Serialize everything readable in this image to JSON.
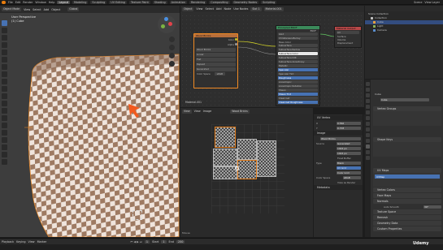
{
  "app": {
    "menu": [
      "File",
      "Edit",
      "Render",
      "Window",
      "Help"
    ],
    "workspaces": [
      "Layout",
      "Modeling",
      "Sculpting",
      "UV Editing",
      "Texture Paint",
      "Shading",
      "Animation",
      "Rendering",
      "Compositing",
      "Geometry Nodes",
      "Scripting"
    ],
    "active_workspace": "Layout",
    "scene": "Scene",
    "view_layer": "View Layer"
  },
  "viewport": {
    "mode": "Object Mode",
    "menus": [
      "View",
      "Select",
      "Add",
      "Object"
    ],
    "view_title": "User Perspective",
    "object_label": "(1) Cube",
    "transform": "Global",
    "cursor_color": "#f25a1e"
  },
  "node_editor": {
    "mode": "Object",
    "menus": [
      "View",
      "Select",
      "Add",
      "Node"
    ],
    "use_nodes": "Use Nodes",
    "slot": "Slot 1",
    "material": "Material.001",
    "material_label": "Material.001",
    "image_node": {
      "title": "Wood Bricks",
      "outputs": [
        "Color",
        "Alpha"
      ],
      "image_name": "Wood Bricks",
      "interpolation": "Linear",
      "projection": "Flat",
      "extension": "Repeat",
      "source": "Generated",
      "color_space": "sRGB",
      "color_space_label": "Color Space"
    },
    "bsdf_node": {
      "title": "Principled BSDF",
      "output": "BSDF",
      "rows": [
        "GGX",
        "Christensen-Burley",
        "Base Color",
        "Subsurface",
        "Subsurface Radius",
        "Subsurface Color",
        "Subsurface IOR",
        "Subsurface Anisotropy",
        "Metallic",
        "Specular",
        "Specular Tint",
        "Roughness",
        "Anisotropic",
        "Anisotropic Rotation",
        "Sheen",
        "Sheen Tint",
        "Clearcoat",
        "Clearcoat Roughness"
      ]
    },
    "output_node": {
      "title": "Material Output",
      "target": "All",
      "inputs": [
        "Surface",
        "Volume",
        "Displacement"
      ]
    }
  },
  "uv_editor": {
    "mode": "View",
    "menus": [
      "View",
      "Image"
    ],
    "image_name": "Wood Bricks",
    "tabs": [
      "Image",
      "Tool",
      "View"
    ],
    "sidebar": {
      "uv_vertex_section": "UV Vertex",
      "x_label": "X",
      "x_value": "0.562",
      "y_label": "Y",
      "y_value": "0.703",
      "image_section": "Image",
      "image_name": "Wood Bricks",
      "source_label": "Source",
      "source_value": "Generated",
      "x_size": "1024 px",
      "y_size": "1024 px",
      "float_buffer": "Float Buffer",
      "type_label": "Type",
      "type_value": "Blank",
      "type_grid": "UV Grid",
      "type_color_grid": "Color Grid",
      "color_space_label": "Color Space",
      "color_space": "sRGB",
      "view_as_render": "View as Render",
      "metadata": "Metadata"
    },
    "footer": "Mouse"
  },
  "outliner": {
    "title": "Scene Collection",
    "items": [
      {
        "name": "Collection",
        "color": "#bfbfbf"
      },
      {
        "name": "Cube",
        "color": "#e9a03b"
      },
      {
        "name": "Light",
        "color": "#8bb35a"
      },
      {
        "name": "Camera",
        "color": "#5a8fd0"
      }
    ]
  },
  "properties": {
    "breadcrumb": "Cube",
    "object_name": "Cube",
    "sections": [
      "Vertex Groups",
      "Shape Keys",
      "UV Maps"
    ],
    "uv_map": "UVMap",
    "more_sections": [
      "Vertex Colors",
      "Face Maps",
      "Normals"
    ],
    "auto_smooth": "Auto Smooth",
    "auto_smooth_angle": "30°",
    "tail_sections": [
      "Texture Space",
      "Remesh",
      "Geometry Data",
      "Custom Properties"
    ]
  },
  "timeline": {
    "items": [
      "Playback",
      "Keying",
      "View",
      "Marker"
    ],
    "current_frame": "1",
    "start_label": "Start",
    "start": "1",
    "end_label": "End",
    "end": "250"
  },
  "watermark": "Udemy"
}
